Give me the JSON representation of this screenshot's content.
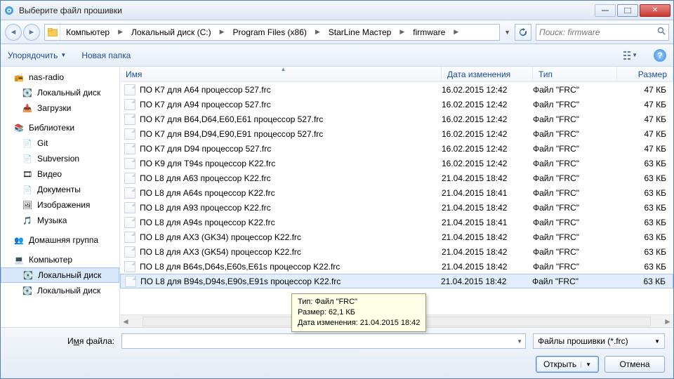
{
  "window": {
    "title": "Выберите файл прошивки"
  },
  "nav": {
    "crumbs": [
      "Компьютер",
      "Локальный диск (C:)",
      "Program Files (x86)",
      "StarLine Мастер",
      "firmware"
    ],
    "search_placeholder": "Поиск: firmware"
  },
  "toolbar": {
    "organize": "Упорядочить",
    "new_folder": "Новая папка"
  },
  "columns": {
    "name": "Имя",
    "date": "Дата изменения",
    "type": "Тип",
    "size": "Размер"
  },
  "sidebar": {
    "items": [
      {
        "label": "nas-radio",
        "icon": "📻",
        "cls": "bold"
      },
      {
        "label": "Локальный диск",
        "icon": "💽",
        "cls": ""
      },
      {
        "label": "Загрузки",
        "icon": "📥",
        "cls": ""
      },
      {
        "label": "Библиотеки",
        "icon": "📚",
        "cls": "group"
      },
      {
        "label": "Git",
        "icon": "📄",
        "cls": ""
      },
      {
        "label": "Subversion",
        "icon": "📄",
        "cls": ""
      },
      {
        "label": "Видео",
        "icon": "🎞",
        "cls": ""
      },
      {
        "label": "Документы",
        "icon": "📄",
        "cls": ""
      },
      {
        "label": "Изображения",
        "icon": "🖼",
        "cls": ""
      },
      {
        "label": "Музыка",
        "icon": "🎵",
        "cls": ""
      },
      {
        "label": "Домашняя группа",
        "icon": "👥",
        "cls": "group"
      },
      {
        "label": "Компьютер",
        "icon": "💻",
        "cls": "group"
      },
      {
        "label": "Локальный диск",
        "icon": "💽",
        "cls": "sel"
      },
      {
        "label": "Локальный диск",
        "icon": "💽",
        "cls": ""
      }
    ]
  },
  "files": [
    {
      "name": "ПО K7 для A64 процессор 527.frc",
      "date": "16.02.2015 12:42",
      "type": "Файл \"FRC\"",
      "size": "47 КБ"
    },
    {
      "name": "ПО K7 для A94 процессор 527.frc",
      "date": "16.02.2015 12:42",
      "type": "Файл \"FRC\"",
      "size": "47 КБ"
    },
    {
      "name": "ПО K7 для B64,D64,E60,E61 процессор 527.frc",
      "date": "16.02.2015 12:42",
      "type": "Файл \"FRC\"",
      "size": "47 КБ"
    },
    {
      "name": "ПО K7 для B94,D94,E90,E91 процессор 527.frc",
      "date": "16.02.2015 12:42",
      "type": "Файл \"FRC\"",
      "size": "47 КБ"
    },
    {
      "name": "ПО K7 для D94 процессор 527.frc",
      "date": "16.02.2015 12:42",
      "type": "Файл \"FRC\"",
      "size": "47 КБ"
    },
    {
      "name": "ПО K9 для T94s процессор K22.frc",
      "date": "16.02.2015 12:42",
      "type": "Файл \"FRC\"",
      "size": "63 КБ"
    },
    {
      "name": "ПО L8 для A63 процессор K22.frc",
      "date": "21.04.2015 18:42",
      "type": "Файл \"FRC\"",
      "size": "63 КБ"
    },
    {
      "name": "ПО L8 для A64s процессор K22.frc",
      "date": "21.04.2015 18:41",
      "type": "Файл \"FRC\"",
      "size": "63 КБ"
    },
    {
      "name": "ПО L8 для A93 процессор K22.frc",
      "date": "21.04.2015 18:42",
      "type": "Файл \"FRC\"",
      "size": "63 КБ"
    },
    {
      "name": "ПО L8 для A94s процессор K22.frc",
      "date": "21.04.2015 18:41",
      "type": "Файл \"FRC\"",
      "size": "63 КБ"
    },
    {
      "name": "ПО L8 для AX3 (GK34) процессор K22.frc",
      "date": "21.04.2015 18:42",
      "type": "Файл \"FRC\"",
      "size": "63 КБ"
    },
    {
      "name": "ПО L8 для AX3 (GK54) процессор K22.frc",
      "date": "21.04.2015 18:42",
      "type": "Файл \"FRC\"",
      "size": "63 КБ"
    },
    {
      "name": "ПО L8 для B64s,D64s,E60s,E61s процессор K22.frc",
      "date": "21.04.2015 18:42",
      "type": "Файл \"FRC\"",
      "size": "63 КБ"
    },
    {
      "name": "ПО L8 для B94s,D94s,E90s,E91s процессор K22.frc",
      "date": "21.04.2015 18:42",
      "type": "Файл \"FRC\"",
      "size": "63 КБ",
      "selected": true
    }
  ],
  "tooltip": {
    "line1": "Тип: Файл \"FRC\"",
    "line2": "Размер: 62,1 КБ",
    "line3": "Дата изменения: 21.04.2015 18:42"
  },
  "bottom": {
    "filename_label_pre": "И",
    "filename_label_u": "м",
    "filename_label_post": "я файла:",
    "filename_value": "",
    "filter": "Файлы прошивки (*.frc)",
    "open": "Открыть",
    "cancel": "Отмена"
  }
}
